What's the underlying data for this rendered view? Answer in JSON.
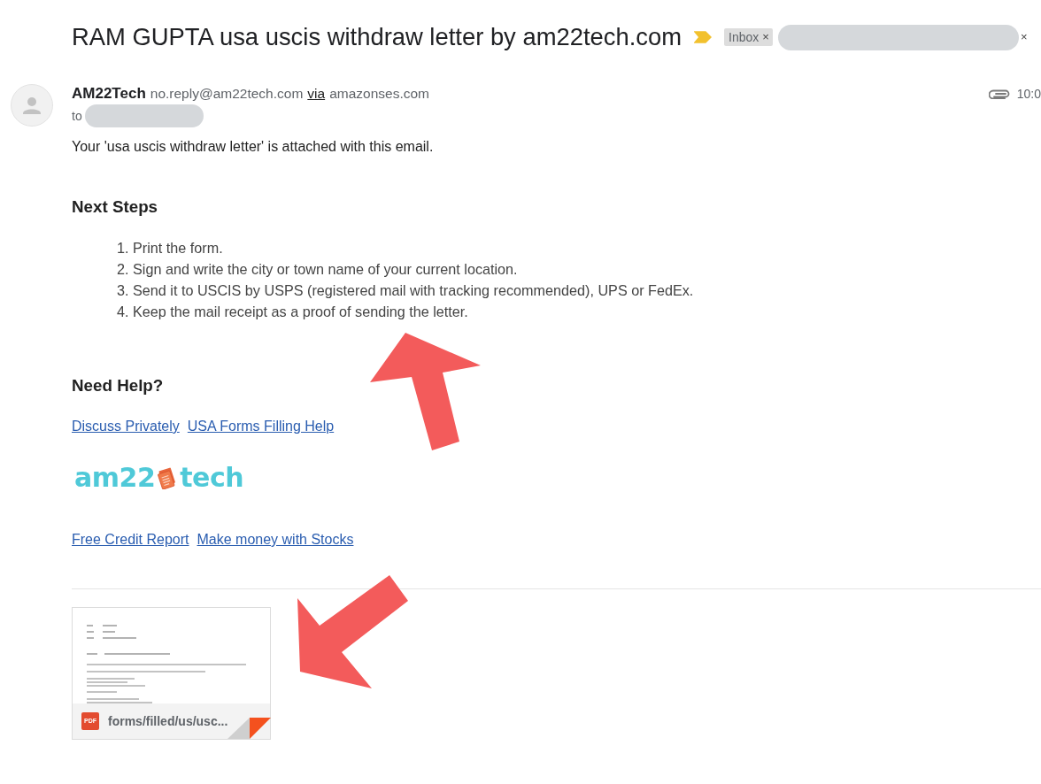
{
  "email": {
    "subject": "RAM GUPTA usa uscis withdraw letter by am22tech.com",
    "important": true,
    "labels": [
      {
        "kind": "text",
        "name": "Inbox",
        "remove": "×"
      },
      {
        "kind": "blurred",
        "remove": "×"
      }
    ],
    "sender": {
      "name": "AM22Tech",
      "address": "no.reply@am22tech.com",
      "via": "via",
      "relay": "amazonses.com"
    },
    "has_attachment": true,
    "time": "10:0",
    "to": {
      "label": "to",
      "recipient": {
        "kind": "blurred"
      }
    },
    "body": {
      "intro": "Your 'usa uscis withdraw letter' is attached with this email.",
      "steps_heading": "Next Steps",
      "steps": [
        {
          "number": "1.",
          "text": "Print the form."
        },
        {
          "number": "2.",
          "text": "Sign and write the city or town name of your current location."
        },
        {
          "number": "3.",
          "text": "Send it to USCIS by USPS (registered mail with tracking recommended), UPS or FedEx."
        },
        {
          "number": "4.",
          "text": "Keep the mail receipt as a proof of sending the letter."
        }
      ],
      "help_heading": "Need Help?",
      "help_links": [
        "Discuss Privately",
        "USA Forms Filling Help"
      ],
      "logo": {
        "parts": [
          "am22",
          "tech"
        ]
      },
      "footer_links": [
        "Free Credit Report",
        "Make money with Stocks"
      ]
    },
    "attachment": {
      "file_type": "PDF",
      "file_name": "forms/filled/us/usc..."
    }
  }
}
